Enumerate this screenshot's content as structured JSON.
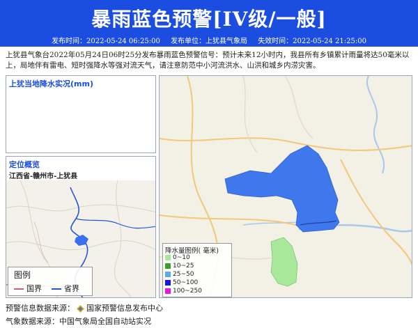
{
  "header": {
    "title": "暴雨蓝色预警[IV级/一般]",
    "publish_time": "发布时间：2022-05-24 06:25:00",
    "publisher": "发布单位：上犹县气象局",
    "expire_time": "失效时间：2022-05-24 21:25:00",
    "color": "#1a4de0"
  },
  "warning_text": "上犹县气象台2022年05月24日06时25分发布暴雨蓝色预警信号：预计未来12小时内，我县所有乡镇累计雨量将达50毫米以上，局地伴有雷电、短时强降水等强对流天气，请注意防范中小河流洪水、山洪和城乡内涝灾害。",
  "rain_panel": {
    "title": "上犹当地降水实况(mm)"
  },
  "location_panel": {
    "title": "定位概览",
    "subtitle": "江西省-赣州市-上犹县"
  },
  "mini_legend": {
    "title": "图例",
    "national_border": "国界",
    "provincial_border": "省界"
  },
  "rain_legend": {
    "title": "降水量图例( 毫米)",
    "items": [
      {
        "label": "0~10",
        "color": "#a8e89a"
      },
      {
        "label": "10~25",
        "color": "#3aa02c"
      },
      {
        "label": "25~50",
        "color": "#5ea8f0"
      },
      {
        "label": "50~100",
        "color": "#1515e8"
      },
      {
        "label": "100~250",
        "color": "#e41ad8"
      }
    ]
  },
  "footer": {
    "source_warning_label": "预警信息数据来源：",
    "source_warning_value": "国家预警信息发布中心",
    "source_weather": "气象数据来源：中国气象局全国自动站实况"
  }
}
